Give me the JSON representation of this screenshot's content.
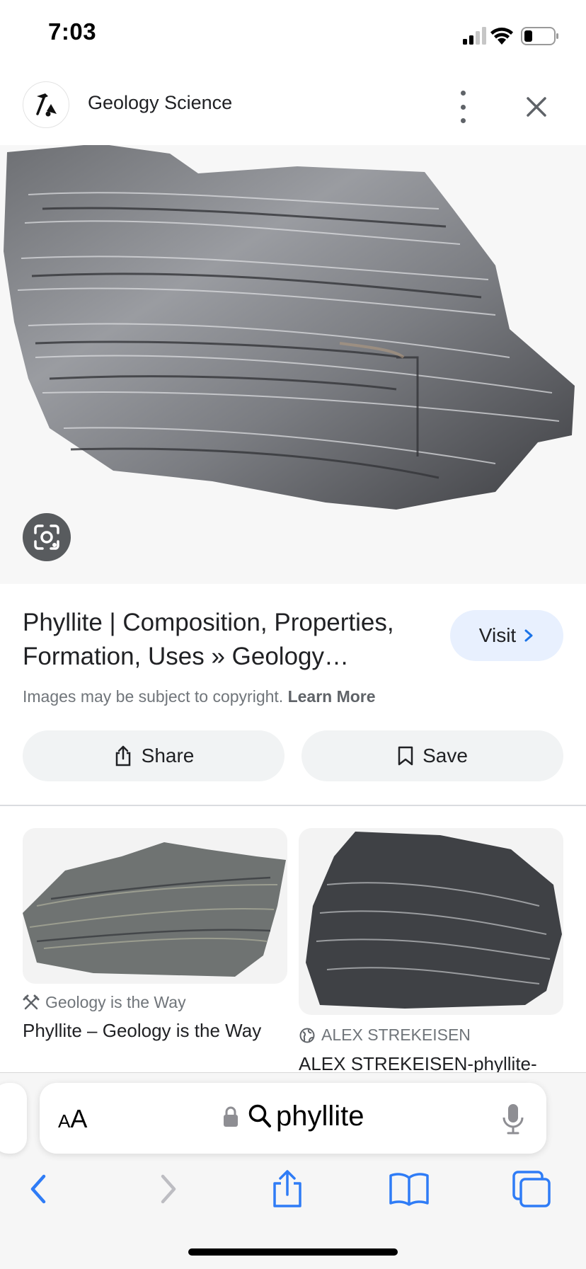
{
  "status_bar": {
    "time": "7:03",
    "signal_icon": "cellular-signal-icon",
    "wifi_icon": "wifi-icon",
    "battery_icon": "battery-low-icon"
  },
  "header": {
    "site_name": "Geology Science",
    "logo_icon": "rock-hammer-logo-icon",
    "more_icon": "more-vert-icon",
    "close_icon": "close-icon"
  },
  "main_image": {
    "subject": "phyllite rock specimen",
    "lens_icon": "google-lens-icon"
  },
  "result": {
    "title": "Phyllite | Composition, Properties, Formation, Uses » Geology…",
    "visit_label": "Visit",
    "copyright_text": "Images may be subject to copyright.",
    "learn_more_label": "Learn More"
  },
  "actions": {
    "share_label": "Share",
    "save_label": "Save"
  },
  "related": [
    {
      "source": "Geology is the Way",
      "title": "Phyllite – Geology is the Way",
      "source_icon": "hammer-pick-icon"
    },
    {
      "source": "ALEX STREKEISEN",
      "title": "ALEX STREKEISEN-phyllite-",
      "source_icon": "globe-icon"
    }
  ],
  "safari": {
    "text_size_label_small": "A",
    "text_size_label_large": "A",
    "address_text": "phyllite",
    "colors": {
      "accent": "#1a73e8",
      "toolbar_blue": "#2f7cf6",
      "visit_bg": "#e8f0fe",
      "pill_bg": "#f1f3f4"
    }
  }
}
